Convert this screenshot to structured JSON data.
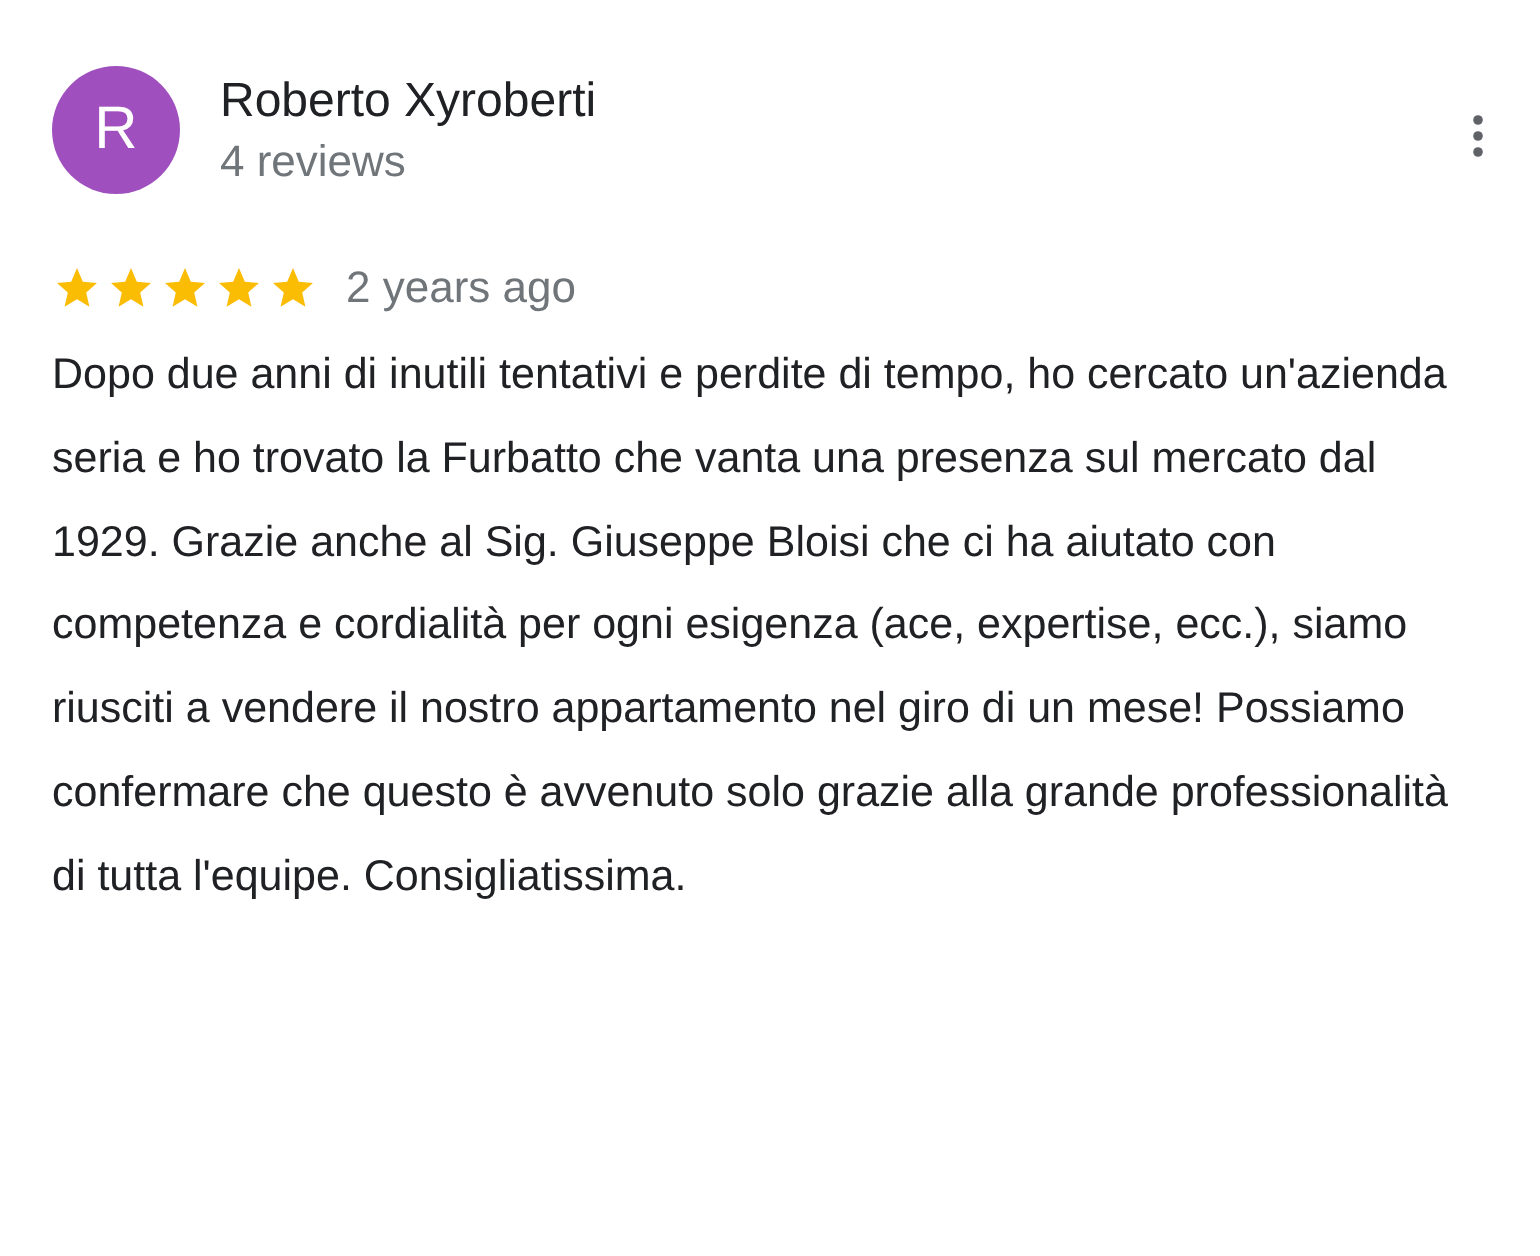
{
  "reviewer": {
    "initial": "R",
    "name": "Roberto Xyroberti",
    "reviews": "4 reviews",
    "color": "#a050be"
  },
  "review": {
    "stars": 5,
    "time": "2 years ago",
    "text": "Dopo due anni di inutili tentativi e perdite di tempo, ho cercato un'azienda seria e ho trovato la Furbatto che vanta una presenza sul mercato dal 1929. Grazie anche al Sig. Giuseppe Bloisi che ci ha aiutato con competenza e cordialità per ogni esigenza (ace, expertise, ecc.), siamo riusciti a vendere il nostro appartamento nel giro di un mese! Possiamo confermare che questo è avvenuto solo grazie alla grande professionalità di tutta l'equipe. Consigliatissima."
  }
}
